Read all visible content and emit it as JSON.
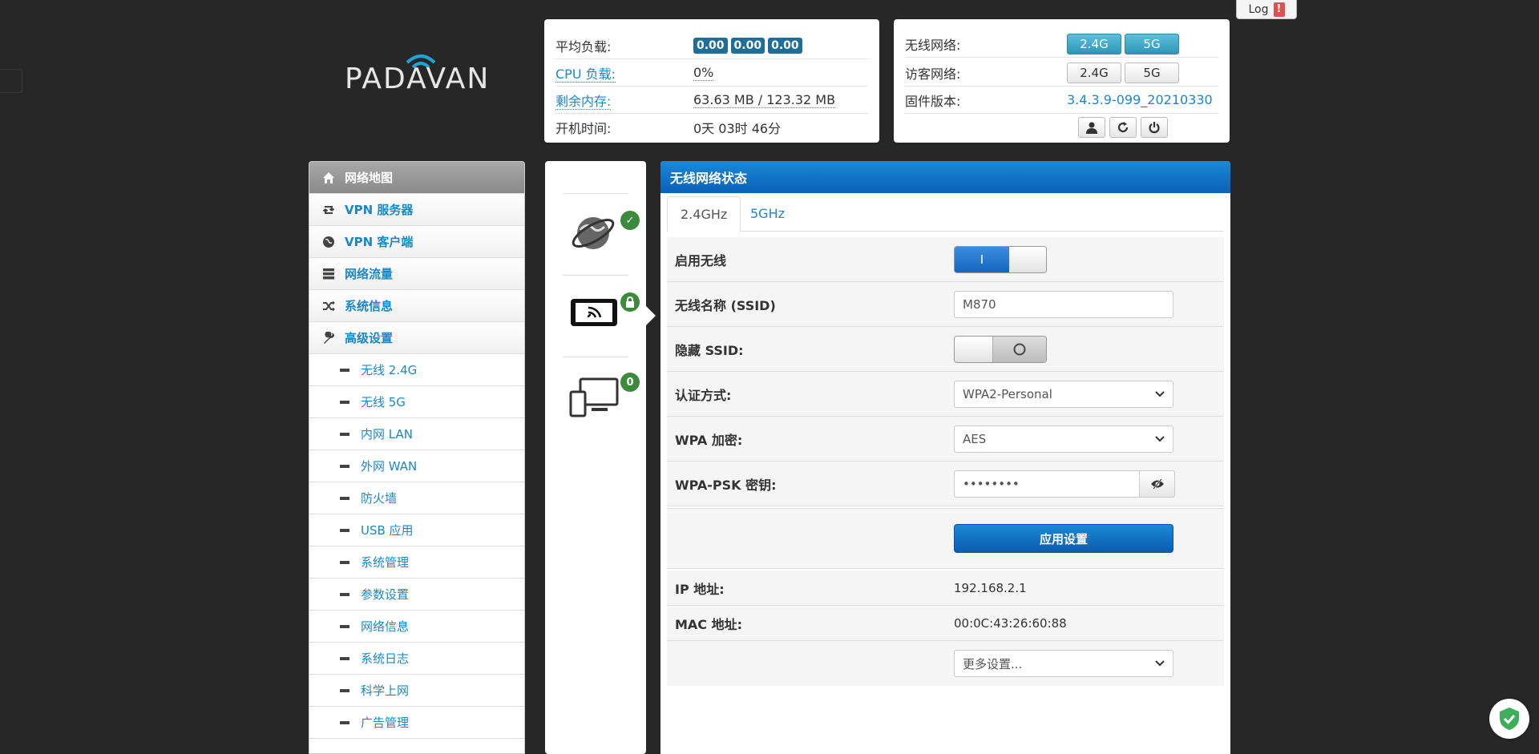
{
  "logo": {
    "text": "PADAVAN"
  },
  "status_box": {
    "load_label": "平均负载:",
    "load_values": [
      "0.00",
      "0.00",
      "0.00"
    ],
    "cpu_label": "CPU 负载:",
    "cpu_value": "0%",
    "mem_label": "剩余内存:",
    "mem_value": "63.63 MB / 123.32 MB",
    "uptime_label": "开机时间:",
    "uptime_value": "0天 03时 46分"
  },
  "wifi_box": {
    "wireless_label": "无线网络:",
    "wireless_btn_24": "2.4G",
    "wireless_btn_5": "5G",
    "guest_label": "访客网络:",
    "guest_btn_24": "2.4G",
    "guest_btn_5": "5G",
    "firmware_label": "固件版本:",
    "firmware_value": "3.4.3.9-099_20210330"
  },
  "log_button": {
    "label": "Log",
    "alert": "!"
  },
  "sidebar": {
    "items": [
      {
        "label": "网络地图",
        "icon": "home-icon"
      },
      {
        "label": "VPN 服务器",
        "icon": "retweet-icon"
      },
      {
        "label": "VPN 客户端",
        "icon": "globe-icon"
      },
      {
        "label": "网络流量",
        "icon": "tasks-icon"
      },
      {
        "label": "系统信息",
        "icon": "random-icon"
      },
      {
        "label": "高级设置",
        "icon": "wrench-icon"
      }
    ],
    "sub_items": [
      "无线 2.4G",
      "无线 5G",
      "内网 LAN",
      "外网 WAN",
      "防火墙",
      "USB 应用",
      "系统管理",
      "参数设置",
      "网络信息",
      "系统日志",
      "科学上网",
      "广告管理"
    ]
  },
  "icon_panel": {
    "clients_count": "0"
  },
  "main": {
    "title": "无线网络状态",
    "tabs": [
      "2.4GHz",
      "5GHz"
    ],
    "enable_label": "启用无线",
    "enable_on_text": "I",
    "ssid_label": "无线名称 (SSID)",
    "ssid_value": "M870",
    "hide_label": "隐藏 SSID:",
    "auth_label": "认证方式:",
    "auth_value": "WPA2-Personal",
    "enc_label": "WPA 加密:",
    "enc_value": "AES",
    "psk_label": "WPA-PSK 密钥:",
    "psk_value": "••••••••",
    "apply_label": "应用设置",
    "ip_label": "IP 地址:",
    "ip_value": "192.168.2.1",
    "mac_label": "MAC 地址:",
    "mac_value": "00:0C:43:26:60:88",
    "more_value": "更多设置..."
  }
}
